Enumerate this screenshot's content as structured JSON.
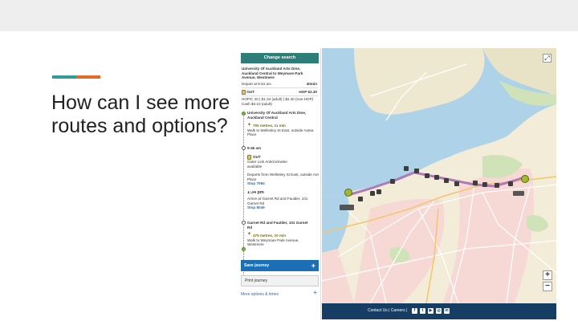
{
  "slide": {
    "title": "How can I see more routes and options?",
    "accent_colors": [
      "#2e9c9a",
      "#e56a25"
    ]
  },
  "journey_panel": {
    "change_search_label": "Change search",
    "origin_line1": "University Of Auckland Arts Dine,",
    "origin_line2": "Auckland Central to Weymare Park",
    "origin_line3": "Avenue, Westmere",
    "depart": "Depart at 9:34 am",
    "duration": "40min",
    "route_badge": "OUT",
    "price": "HOP $3.30",
    "fare_line1": "HOP/C 20 | $1.34 (adult) | $2.40 (non-HOP)",
    "fare_line2": "Cash $3.10 (adult)",
    "start_stop_line1": "University Of Auckland Arts Dine,",
    "start_stop_line2": "Auckland Central",
    "walk1": "700 metres, 11 min",
    "walk1_to_line1": "Walk to Wellesley St East, outside Aotea",
    "walk1_to_line2": "Place",
    "time1": "9:46 am",
    "bus_route": "OUT",
    "bus_name_line1": "Outer Link Anticlockwise",
    "bus_name_line2": "available",
    "bus_depart_line1": "Departs from Wellesley St East, outside Aotea",
    "bus_depart_line2": "Place",
    "bus_stop_link": "Stop 7094",
    "time2": "1:34 pm",
    "arrive_line1": "Arrive at Garnet Rd and Faulder, 101",
    "arrive_line2": "Garnet Rd",
    "arrive_stop_link": "Stop 8049",
    "end_stop_line1": "Garnet Rd and Faulder, 101 Garnet",
    "end_stop_line2": "Rd",
    "walk2": "475 metres, 10 min",
    "walk2_to_line1": "Walk to Weymare Park Avenue,",
    "walk2_to_line2": "Westmere",
    "save_journey": "Save journey",
    "print_journey": "Print journey",
    "more_options": "More options & times"
  },
  "map": {
    "fullscreen_icon": "fullscreen-icon",
    "zoom_in": "+",
    "zoom_out": "−",
    "route_color": "#b07ab8",
    "water_color": "#aed3e8",
    "land_color": "#f2ecd8"
  },
  "footer": {
    "text": "Contact Us | Careers |",
    "social": [
      "f",
      "t",
      "▶",
      "◎",
      "in"
    ],
    "color": "#163e64"
  }
}
